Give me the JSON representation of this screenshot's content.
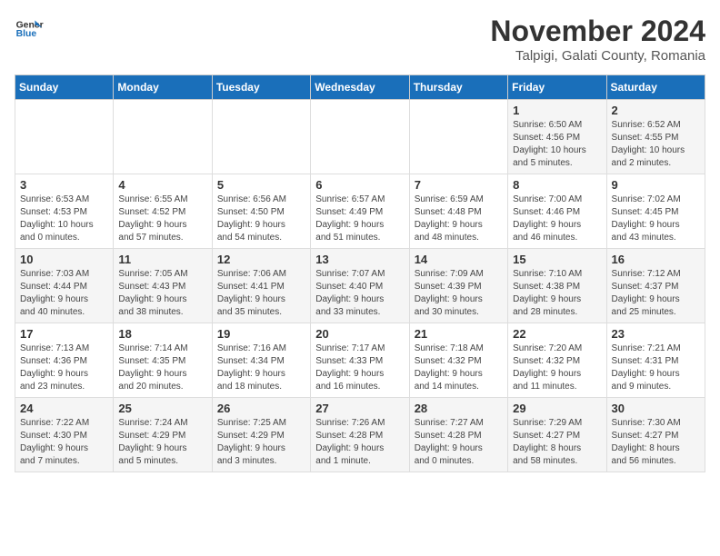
{
  "logo": {
    "line1": "General",
    "line2": "Blue"
  },
  "title": "November 2024",
  "subtitle": "Talpigi, Galati County, Romania",
  "weekdays": [
    "Sunday",
    "Monday",
    "Tuesday",
    "Wednesday",
    "Thursday",
    "Friday",
    "Saturday"
  ],
  "weeks": [
    [
      {
        "day": "",
        "info": ""
      },
      {
        "day": "",
        "info": ""
      },
      {
        "day": "",
        "info": ""
      },
      {
        "day": "",
        "info": ""
      },
      {
        "day": "",
        "info": ""
      },
      {
        "day": "1",
        "info": "Sunrise: 6:50 AM\nSunset: 4:56 PM\nDaylight: 10 hours\nand 5 minutes."
      },
      {
        "day": "2",
        "info": "Sunrise: 6:52 AM\nSunset: 4:55 PM\nDaylight: 10 hours\nand 2 minutes."
      }
    ],
    [
      {
        "day": "3",
        "info": "Sunrise: 6:53 AM\nSunset: 4:53 PM\nDaylight: 10 hours\nand 0 minutes."
      },
      {
        "day": "4",
        "info": "Sunrise: 6:55 AM\nSunset: 4:52 PM\nDaylight: 9 hours\nand 57 minutes."
      },
      {
        "day": "5",
        "info": "Sunrise: 6:56 AM\nSunset: 4:50 PM\nDaylight: 9 hours\nand 54 minutes."
      },
      {
        "day": "6",
        "info": "Sunrise: 6:57 AM\nSunset: 4:49 PM\nDaylight: 9 hours\nand 51 minutes."
      },
      {
        "day": "7",
        "info": "Sunrise: 6:59 AM\nSunset: 4:48 PM\nDaylight: 9 hours\nand 48 minutes."
      },
      {
        "day": "8",
        "info": "Sunrise: 7:00 AM\nSunset: 4:46 PM\nDaylight: 9 hours\nand 46 minutes."
      },
      {
        "day": "9",
        "info": "Sunrise: 7:02 AM\nSunset: 4:45 PM\nDaylight: 9 hours\nand 43 minutes."
      }
    ],
    [
      {
        "day": "10",
        "info": "Sunrise: 7:03 AM\nSunset: 4:44 PM\nDaylight: 9 hours\nand 40 minutes."
      },
      {
        "day": "11",
        "info": "Sunrise: 7:05 AM\nSunset: 4:43 PM\nDaylight: 9 hours\nand 38 minutes."
      },
      {
        "day": "12",
        "info": "Sunrise: 7:06 AM\nSunset: 4:41 PM\nDaylight: 9 hours\nand 35 minutes."
      },
      {
        "day": "13",
        "info": "Sunrise: 7:07 AM\nSunset: 4:40 PM\nDaylight: 9 hours\nand 33 minutes."
      },
      {
        "day": "14",
        "info": "Sunrise: 7:09 AM\nSunset: 4:39 PM\nDaylight: 9 hours\nand 30 minutes."
      },
      {
        "day": "15",
        "info": "Sunrise: 7:10 AM\nSunset: 4:38 PM\nDaylight: 9 hours\nand 28 minutes."
      },
      {
        "day": "16",
        "info": "Sunrise: 7:12 AM\nSunset: 4:37 PM\nDaylight: 9 hours\nand 25 minutes."
      }
    ],
    [
      {
        "day": "17",
        "info": "Sunrise: 7:13 AM\nSunset: 4:36 PM\nDaylight: 9 hours\nand 23 minutes."
      },
      {
        "day": "18",
        "info": "Sunrise: 7:14 AM\nSunset: 4:35 PM\nDaylight: 9 hours\nand 20 minutes."
      },
      {
        "day": "19",
        "info": "Sunrise: 7:16 AM\nSunset: 4:34 PM\nDaylight: 9 hours\nand 18 minutes."
      },
      {
        "day": "20",
        "info": "Sunrise: 7:17 AM\nSunset: 4:33 PM\nDaylight: 9 hours\nand 16 minutes."
      },
      {
        "day": "21",
        "info": "Sunrise: 7:18 AM\nSunset: 4:32 PM\nDaylight: 9 hours\nand 14 minutes."
      },
      {
        "day": "22",
        "info": "Sunrise: 7:20 AM\nSunset: 4:32 PM\nDaylight: 9 hours\nand 11 minutes."
      },
      {
        "day": "23",
        "info": "Sunrise: 7:21 AM\nSunset: 4:31 PM\nDaylight: 9 hours\nand 9 minutes."
      }
    ],
    [
      {
        "day": "24",
        "info": "Sunrise: 7:22 AM\nSunset: 4:30 PM\nDaylight: 9 hours\nand 7 minutes."
      },
      {
        "day": "25",
        "info": "Sunrise: 7:24 AM\nSunset: 4:29 PM\nDaylight: 9 hours\nand 5 minutes."
      },
      {
        "day": "26",
        "info": "Sunrise: 7:25 AM\nSunset: 4:29 PM\nDaylight: 9 hours\nand 3 minutes."
      },
      {
        "day": "27",
        "info": "Sunrise: 7:26 AM\nSunset: 4:28 PM\nDaylight: 9 hours\nand 1 minute."
      },
      {
        "day": "28",
        "info": "Sunrise: 7:27 AM\nSunset: 4:28 PM\nDaylight: 9 hours\nand 0 minutes."
      },
      {
        "day": "29",
        "info": "Sunrise: 7:29 AM\nSunset: 4:27 PM\nDaylight: 8 hours\nand 58 minutes."
      },
      {
        "day": "30",
        "info": "Sunrise: 7:30 AM\nSunset: 4:27 PM\nDaylight: 8 hours\nand 56 minutes."
      }
    ]
  ]
}
